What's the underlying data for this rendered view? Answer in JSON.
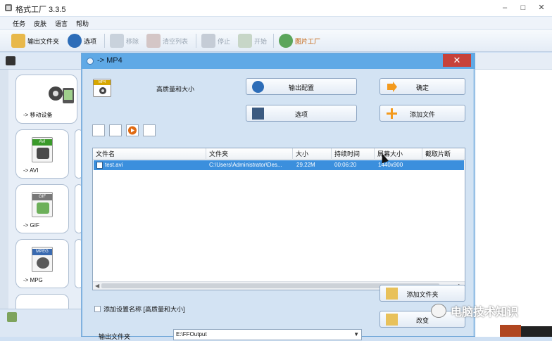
{
  "window": {
    "title": "格式工厂 3.3.5",
    "controls": [
      "–",
      "□",
      "✕"
    ]
  },
  "menu": [
    "任务",
    "皮肤",
    "语言",
    "帮助"
  ],
  "toolbar": {
    "output_folder": "输出文件夹",
    "options": "选项",
    "remove": "移除",
    "clear_list": "清空列表",
    "stop": "停止",
    "start": "开始",
    "picture_factory": "图片工厂"
  },
  "categories": [
    {
      "label": "-> 移动设备",
      "icon": "mobile-device-icon"
    },
    {
      "label": "-> AVI",
      "tile": "AVI",
      "color": "#3a9a2a"
    },
    {
      "label": "-> GIF",
      "tile": "GIF",
      "color": "#777777"
    },
    {
      "label": "-> MPG",
      "tile": "MPEG",
      "color": "#3a6ab0"
    }
  ],
  "dialog": {
    "title": "-> MP4",
    "close": "✕",
    "tile": "MP4",
    "quality": "高质量和大小",
    "buttons": {
      "output_config": "输出配置",
      "ok": "确定",
      "options": "选项",
      "add_file": "添加文件",
      "add_folder": "添加文件夹",
      "change": "改变"
    },
    "table": {
      "columns": [
        "文件名",
        "文件夹",
        "大小",
        "持续时间",
        "屏幕大小",
        "截取片断"
      ],
      "rows": [
        [
          "test.avi",
          "C:\\Users\\Administrator\\Des...",
          "29.22M",
          "00:06:20",
          "1440x900",
          ""
        ]
      ]
    },
    "checkbox_label": "添加设置名称 [高质量和大小]",
    "output_folder_label": "输出文件夹",
    "output_folder_value": "E:\\FFOutput"
  },
  "watermark": "电脑技术知识"
}
